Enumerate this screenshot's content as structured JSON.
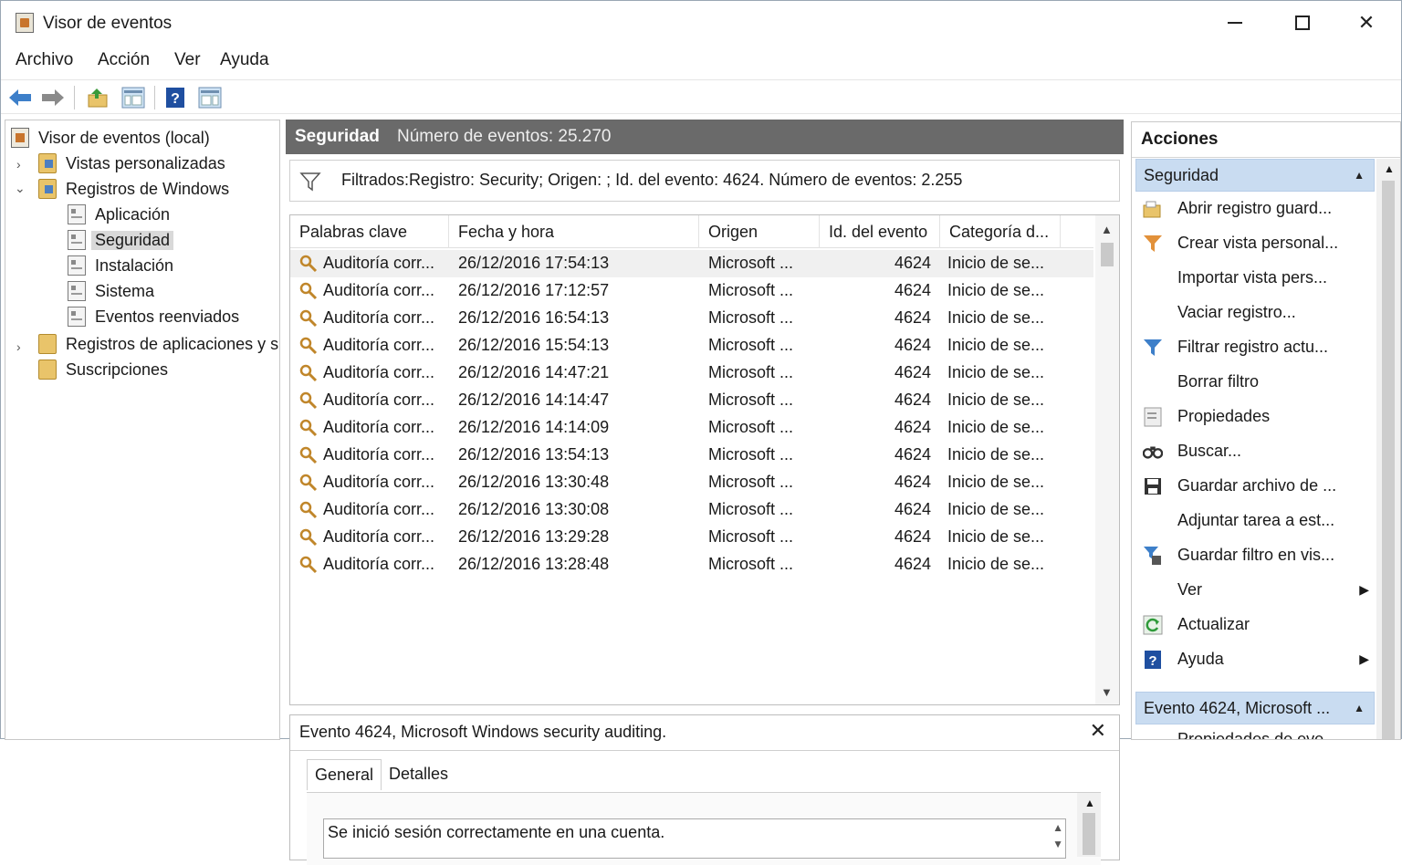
{
  "window": {
    "title": "Visor de eventos",
    "minimize_icon": "minimize-icon",
    "maximize_icon": "maximize-icon",
    "close_icon": "close-icon"
  },
  "menu": [
    "Archivo",
    "Acción",
    "Ver",
    "Ayuda"
  ],
  "toolbar": {
    "icons": [
      "back-arrow-icon",
      "forward-arrow-icon",
      "up-folder-icon",
      "show-hide-tree-icon",
      "help-icon",
      "show-hide-action-icon"
    ]
  },
  "tree": {
    "root": "Visor de eventos (local)",
    "custom_views": "Vistas personalizadas",
    "windows_logs": "Registros de Windows",
    "logs": [
      "Aplicación",
      "Seguridad",
      "Instalación",
      "Sistema",
      "Eventos reenviados"
    ],
    "app_logs": "Registros de aplicaciones y s",
    "subscriptions": "Suscripciones",
    "selected": "Seguridad"
  },
  "log_header": {
    "name": "Seguridad",
    "count_label": "Número de eventos: 25.270"
  },
  "filter": {
    "text": "Filtrados:Registro: Security; Origen: ; Id. del evento: 4624. Número de eventos: 2.255"
  },
  "table": {
    "columns": [
      "Palabras clave",
      "Fecha y hora",
      "Origen",
      "Id. del evento",
      "Categoría d..."
    ],
    "rows": [
      {
        "keywords": "Auditoría corr...",
        "datetime": "26/12/2016 17:54:13",
        "source": "Microsoft ...",
        "id": "4624",
        "category": "Inicio de se..."
      },
      {
        "keywords": "Auditoría corr...",
        "datetime": "26/12/2016 17:12:57",
        "source": "Microsoft ...",
        "id": "4624",
        "category": "Inicio de se..."
      },
      {
        "keywords": "Auditoría corr...",
        "datetime": "26/12/2016 16:54:13",
        "source": "Microsoft ...",
        "id": "4624",
        "category": "Inicio de se..."
      },
      {
        "keywords": "Auditoría corr...",
        "datetime": "26/12/2016 15:54:13",
        "source": "Microsoft ...",
        "id": "4624",
        "category": "Inicio de se..."
      },
      {
        "keywords": "Auditoría corr...",
        "datetime": "26/12/2016 14:47:21",
        "source": "Microsoft ...",
        "id": "4624",
        "category": "Inicio de se..."
      },
      {
        "keywords": "Auditoría corr...",
        "datetime": "26/12/2016 14:14:47",
        "source": "Microsoft ...",
        "id": "4624",
        "category": "Inicio de se..."
      },
      {
        "keywords": "Auditoría corr...",
        "datetime": "26/12/2016 14:14:09",
        "source": "Microsoft ...",
        "id": "4624",
        "category": "Inicio de se..."
      },
      {
        "keywords": "Auditoría corr...",
        "datetime": "26/12/2016 13:54:13",
        "source": "Microsoft ...",
        "id": "4624",
        "category": "Inicio de se..."
      },
      {
        "keywords": "Auditoría corr...",
        "datetime": "26/12/2016 13:30:48",
        "source": "Microsoft ...",
        "id": "4624",
        "category": "Inicio de se..."
      },
      {
        "keywords": "Auditoría corr...",
        "datetime": "26/12/2016 13:30:08",
        "source": "Microsoft ...",
        "id": "4624",
        "category": "Inicio de se..."
      },
      {
        "keywords": "Auditoría corr...",
        "datetime": "26/12/2016 13:29:28",
        "source": "Microsoft ...",
        "id": "4624",
        "category": "Inicio de se..."
      },
      {
        "keywords": "Auditoría corr...",
        "datetime": "26/12/2016 13:28:48",
        "source": "Microsoft ...",
        "id": "4624",
        "category": "Inicio de se..."
      }
    ]
  },
  "detail": {
    "title": "Evento 4624, Microsoft Windows security auditing.",
    "tabs": [
      "General",
      "Detalles"
    ],
    "active_tab": "General",
    "message": "Se inició sesión correctamente en una cuenta."
  },
  "actions": {
    "title": "Acciones",
    "section1": "Seguridad",
    "items": [
      {
        "label": "Abrir registro guard...",
        "icon": "open-log-icon",
        "submenu": false
      },
      {
        "label": "Crear vista personal...",
        "icon": "create-view-icon",
        "submenu": false
      },
      {
        "label": "Importar vista pers...",
        "icon": "",
        "submenu": false
      },
      {
        "label": "Vaciar registro...",
        "icon": "",
        "submenu": false
      },
      {
        "label": "Filtrar registro actu...",
        "icon": "filter-icon",
        "submenu": false
      },
      {
        "label": "Borrar filtro",
        "icon": "",
        "submenu": false
      },
      {
        "label": "Propiedades",
        "icon": "properties-icon",
        "submenu": false
      },
      {
        "label": "Buscar...",
        "icon": "find-icon",
        "submenu": false
      },
      {
        "label": "Guardar archivo de ...",
        "icon": "save-icon",
        "submenu": false
      },
      {
        "label": "Adjuntar tarea a est...",
        "icon": "",
        "submenu": false
      },
      {
        "label": "Guardar filtro en vis...",
        "icon": "save-filter-icon",
        "submenu": false
      },
      {
        "label": "Ver",
        "icon": "",
        "submenu": true
      },
      {
        "label": "Actualizar",
        "icon": "refresh-icon",
        "submenu": false
      },
      {
        "label": "Ayuda",
        "icon": "help-icon",
        "submenu": true
      }
    ],
    "section2": "Evento 4624, Microsoft ...",
    "next_item": "Propiedades de eve..."
  }
}
